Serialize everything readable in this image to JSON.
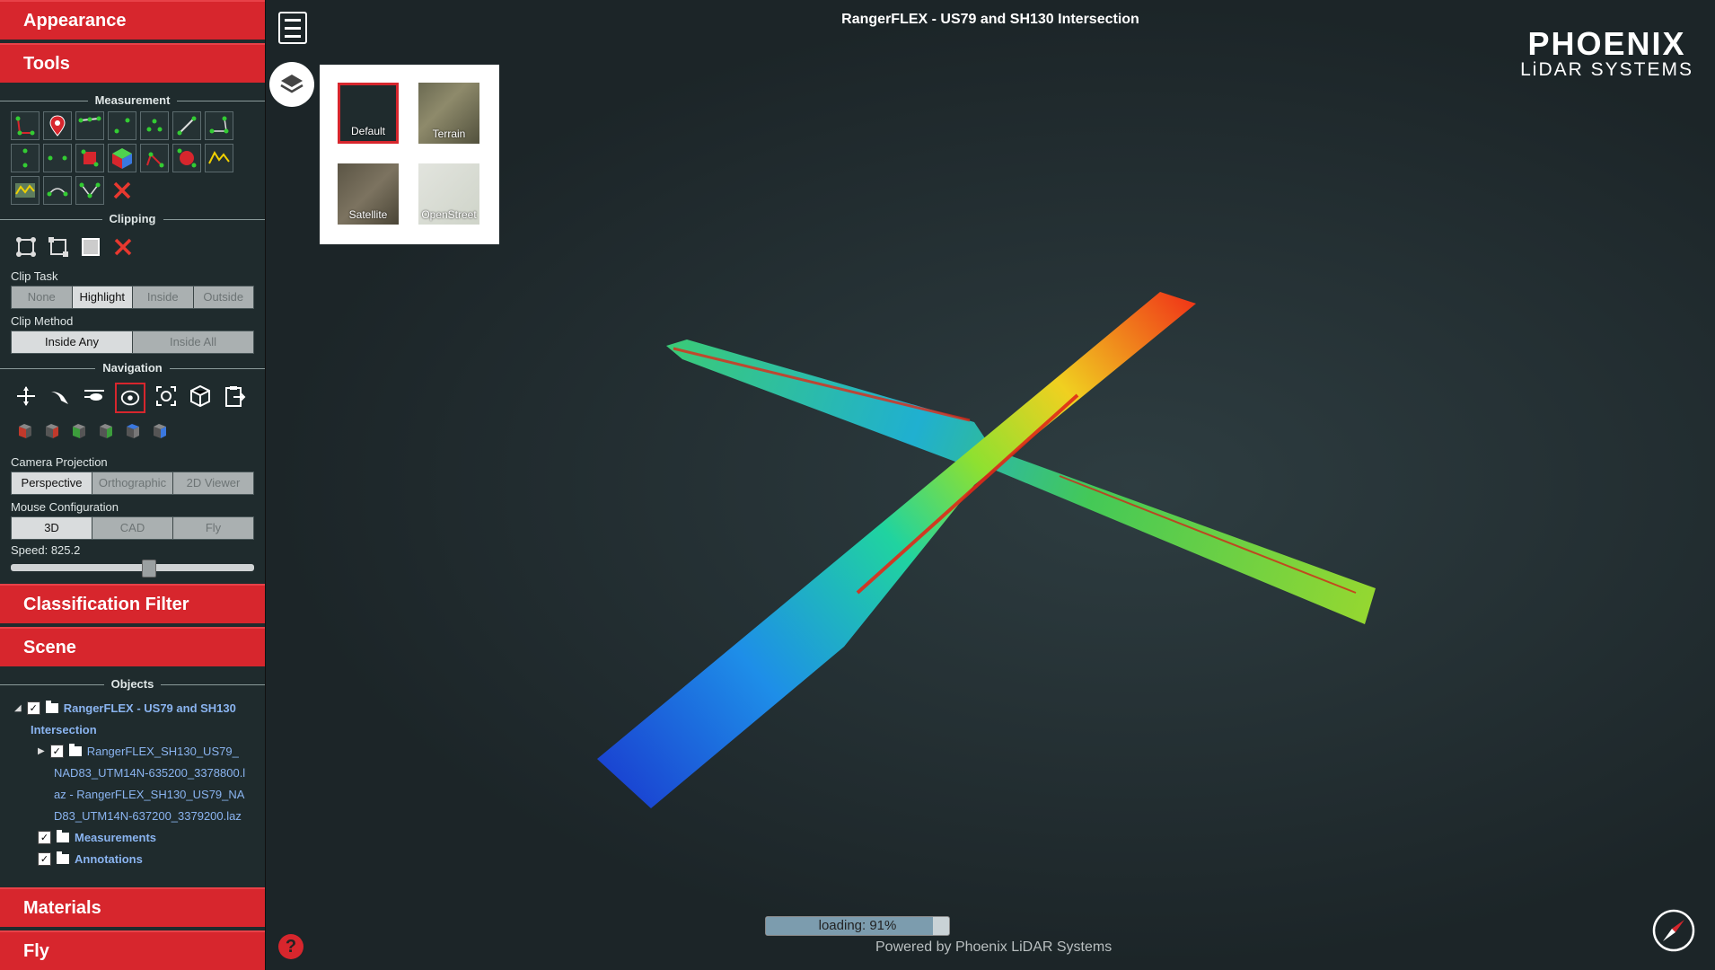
{
  "sidebar": {
    "headers": {
      "appearance": "Appearance",
      "tools": "Tools",
      "classification": "Classification Filter",
      "scene": "Scene",
      "materials": "Materials",
      "fly": "Fly"
    },
    "sections": {
      "measurement": "Measurement",
      "clipping": "Clipping",
      "navigation": "Navigation",
      "objects": "Objects"
    },
    "clip_task": {
      "label": "Clip Task",
      "options": [
        "None",
        "Highlight",
        "Inside",
        "Outside"
      ],
      "selected": "Highlight"
    },
    "clip_method": {
      "label": "Clip Method",
      "options": [
        "Inside Any",
        "Inside All"
      ],
      "selected": "Inside Any"
    },
    "camera_projection": {
      "label": "Camera Projection",
      "options": [
        "Perspective",
        "Orthographic",
        "2D Viewer"
      ],
      "selected": "Perspective"
    },
    "mouse_config": {
      "label": "Mouse Configuration",
      "options": [
        "3D",
        "CAD",
        "Fly"
      ],
      "selected": "3D"
    },
    "speed": {
      "label": "Speed: 825.2",
      "value_fraction": 0.54
    },
    "tree": {
      "root": "RangerFLEX - US79 and SH130",
      "root_cont": "Intersection",
      "child_lines": [
        "RangerFLEX_SH130_US79_",
        "NAD83_UTM14N-635200_3378800.l",
        "az - RangerFLEX_SH130_US79_NA",
        "D83_UTM14N-637200_3379200.laz"
      ],
      "measurements": "Measurements",
      "annotations": "Annotations"
    }
  },
  "viewer": {
    "title": "RangerFLEX - US79 and SH130 Intersection",
    "logo_line1": "PHOENIX",
    "logo_line2": "LiDAR SYSTEMS",
    "basemaps": [
      {
        "label": "Default",
        "selected": true,
        "color": "#1f2b2d"
      },
      {
        "label": "Terrain",
        "selected": false,
        "color": "#6b6a52"
      },
      {
        "label": "Satellite",
        "selected": false,
        "color": "#5b5545"
      },
      {
        "label": "OpenStreet",
        "selected": false,
        "color": "#d4d6d0"
      }
    ],
    "loading_text": "loading: 91%",
    "loading_percent": 91,
    "powered": "Powered by Phoenix LiDAR Systems",
    "help": "?"
  },
  "colors": {
    "accent": "#d7262d",
    "sidebar_bg": "#1f2b2d",
    "link": "#8ab4f0"
  }
}
